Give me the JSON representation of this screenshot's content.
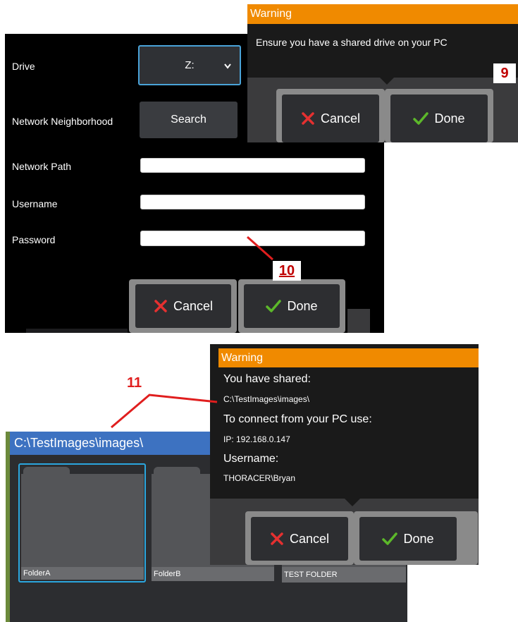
{
  "network": {
    "drive_label": "Drive",
    "drive_value": "Z:",
    "neighborhood_label": "Network Neighborhood",
    "search_label": "Search",
    "path_label": "Network Path",
    "username_label": "Username",
    "password_label": "Password",
    "cancel_label": "Cancel",
    "done_label": "Done"
  },
  "warning1": {
    "title": "Warning",
    "message": "Ensure you have a shared drive on your PC",
    "cancel_label": "Cancel",
    "done_label": "Done"
  },
  "warning2": {
    "title": "Warning",
    "shared_heading": "You have shared:",
    "shared_path": "C:\\TestImages\\images\\",
    "connect_heading": "To connect from your PC use:",
    "ip": "IP: 192.168.0.147",
    "username_heading": "Username:",
    "username_value": "THORACER\\Bryan",
    "cancel_label": "Cancel",
    "done_label": "Done"
  },
  "browser": {
    "path": "C:\\TestImages\\images\\",
    "folders": [
      "FolderA",
      "FolderB",
      "TEST FOLDER"
    ]
  },
  "callouts": {
    "step9": "9",
    "step10": "10",
    "step11": "11"
  },
  "colors": {
    "warning_title": "#f08a00",
    "accent_blue": "#4aa3d8",
    "callout_red": "#e01e1e",
    "cancel_x": "#e53030",
    "done_check": "#5cb82a"
  }
}
